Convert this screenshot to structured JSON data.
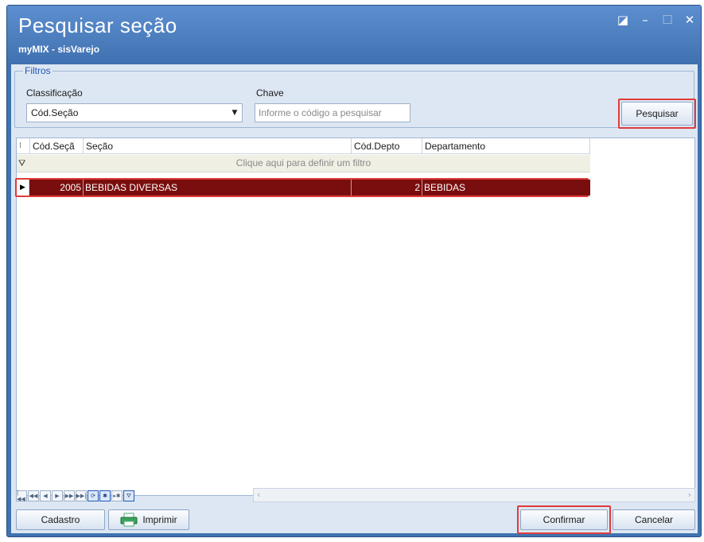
{
  "window": {
    "title": "Pesquisar seção",
    "subtitle": "myMIX - sisVarejo",
    "buttons": [
      "restore-icon",
      "minimize-icon",
      "maximize-icon",
      "close-icon"
    ]
  },
  "filters": {
    "legend": "Filtros",
    "classificacao_label": "Classificação",
    "classificacao_value": "Cód.Seção",
    "chave_label": "Chave",
    "chave_placeholder": "Informe o código a pesquisar",
    "pesquisar_button": "Pesquisar"
  },
  "grid": {
    "columns": [
      "Cód.Seçã",
      "Seção",
      "Cód.Depto",
      "Departamento"
    ],
    "filter_hint": "Clique aqui para definir um filtro",
    "rows": [
      {
        "cod_secao": "2005",
        "secao": "BEBIDAS DIVERSAS",
        "cod_depto": "2",
        "departamento": "BEBIDAS"
      }
    ]
  },
  "footer": {
    "cadastro": "Cadastro",
    "imprimir": "Imprimir",
    "confirmar": "Confirmar",
    "cancelar": "Cancelar"
  },
  "colors": {
    "title_bar": "#3f72b0",
    "selected_row": "#7a0e0e",
    "highlight": "#e03b3b"
  }
}
